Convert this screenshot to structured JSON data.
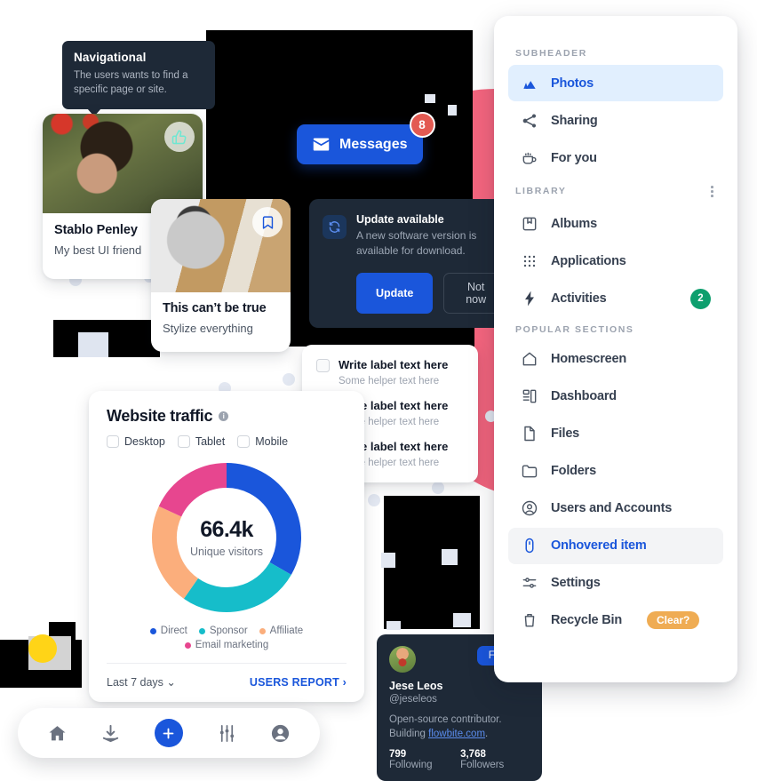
{
  "tooltip": {
    "title": "Navigational",
    "body": "The users wants to find a specific page or site."
  },
  "photo_card_1": {
    "name": "Stablo Penley",
    "subtitle": "My best UI friend",
    "like_icon": "thumbs-up-icon"
  },
  "photo_card_2": {
    "title": "This can’t be true",
    "subtitle": "Stylize everything",
    "bookmark_icon": "bookmark-icon"
  },
  "messages": {
    "label": "Messages",
    "badge": "8",
    "icon": "envelope-icon",
    "color": "#1A56DB",
    "badge_color": "#E35A52"
  },
  "toast": {
    "icon": "refresh-icon",
    "title": "Update available",
    "description": "A new software version is available for download.",
    "primary_label": "Update",
    "secondary_label": "Not now",
    "close_icon": "close-icon"
  },
  "checkbox_panel": {
    "items": [
      {
        "label": "Write label text here",
        "helper": "Some helper text here"
      },
      {
        "label": "Write label text here",
        "helper": "Some helper text here"
      },
      {
        "label": "Write label text here",
        "helper": "Some helper text here"
      }
    ]
  },
  "traffic": {
    "title": "Website traffic",
    "info_icon": "info-icon",
    "tabs": [
      "Desktop",
      "Tablet",
      "Mobile"
    ],
    "center_value": "66.4k",
    "center_caption": "Unique visitors",
    "range_label": "Last 7 days",
    "range_icon": "chevron-down-icon",
    "report_label": "USERS REPORT",
    "report_icon": "chevron-right-icon"
  },
  "chart_data": {
    "type": "pie",
    "title": "Website traffic",
    "subtitle": "Unique visitors",
    "center_label": "66.4k",
    "total": 66400,
    "unit": "visitors",
    "legend_position": "bottom",
    "categories": [
      "Direct",
      "Sponsor",
      "Affiliate",
      "Email marketing"
    ],
    "values": [
      33.3,
      26.4,
      22.2,
      18.1
    ],
    "colors": [
      "#1A56DB",
      "#16BDCA",
      "#FBAE7C",
      "#E7468F"
    ],
    "donut": true,
    "start_angle": 0
  },
  "profile": {
    "name": "Jese Leos",
    "handle": "@jeseleos",
    "bio_prefix": "Open-source contributor. Building ",
    "bio_link": "flowbite.com",
    "bio_suffix": ".",
    "follow_label": "Follow",
    "following_count": "799",
    "following_label": "Following",
    "followers_count": "3,768",
    "followers_label": "Followers"
  },
  "bottom_nav": {
    "items": [
      {
        "icon": "home-icon"
      },
      {
        "icon": "download-icon"
      },
      {
        "icon": "plus-icon"
      },
      {
        "icon": "sliders-icon"
      },
      {
        "icon": "account-icon"
      }
    ]
  },
  "sidebar": {
    "sections": [
      {
        "header": "SUBHEADER",
        "kebab": false,
        "items": [
          {
            "label": "Photos",
            "icon": "mountains-icon",
            "state": "active"
          },
          {
            "label": "Sharing",
            "icon": "share-icon",
            "state": "normal"
          },
          {
            "label": "For you",
            "icon": "coffee-icon",
            "state": "normal"
          }
        ]
      },
      {
        "header": "LIBRARY",
        "kebab": true,
        "items": [
          {
            "label": "Albums",
            "icon": "album-icon",
            "state": "normal"
          },
          {
            "label": "Applications",
            "icon": "grid-icon",
            "state": "normal"
          },
          {
            "label": "Activities",
            "icon": "bolt-icon",
            "state": "normal",
            "badge": "2"
          }
        ]
      },
      {
        "header": "POPULAR SECTIONS",
        "kebab": false,
        "items": [
          {
            "label": "Homescreen",
            "icon": "home-outline-icon",
            "state": "normal"
          },
          {
            "label": "Dashboard",
            "icon": "dashboard-icon",
            "state": "normal"
          },
          {
            "label": "Files",
            "icon": "file-icon",
            "state": "normal"
          },
          {
            "label": "Folders",
            "icon": "folder-icon",
            "state": "normal"
          },
          {
            "label": "Users and Accounts",
            "icon": "user-circle-icon",
            "state": "normal"
          },
          {
            "label": "Onhovered item",
            "icon": "mouse-icon",
            "state": "hovered"
          },
          {
            "label": "Settings",
            "icon": "adjustments-icon",
            "state": "normal"
          },
          {
            "label": "Recycle Bin",
            "icon": "trash-icon",
            "state": "normal",
            "pill": "Clear?"
          }
        ]
      }
    ]
  },
  "colors": {
    "brand_blue": "#1A56DB",
    "active_bg": "#E1EFFE",
    "green_badge": "#0E9F6E",
    "orange_pill": "#EFAC53",
    "pink_blob": "#F4657E",
    "dark_surface": "#1E2937"
  }
}
